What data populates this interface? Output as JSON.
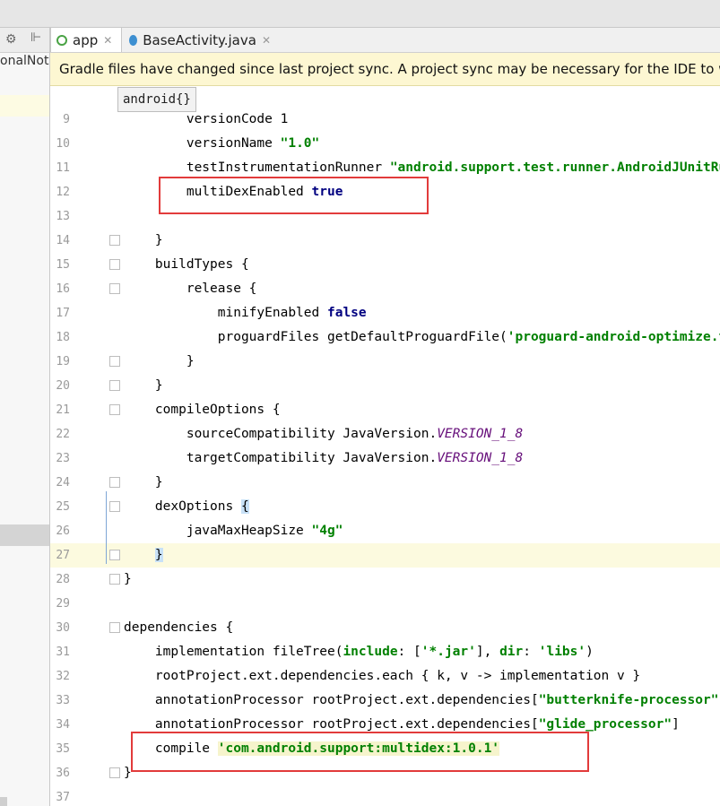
{
  "left_panel": {
    "text": "onalNot",
    "gear_icon": "⚙",
    "pin_icon": "⊩"
  },
  "tabs": [
    {
      "label": "app",
      "icon": "gradle-icon",
      "color": "#4aa345",
      "active": true
    },
    {
      "label": "BaseActivity.java",
      "icon": "class-icon",
      "color": "#3d8fd1",
      "active": false
    }
  ],
  "banner": {
    "text": "Gradle files have changed since last project sync. A project sync may be necessary for the IDE to work"
  },
  "breadcrumb": {
    "text": "android{}"
  },
  "lines": [
    {
      "n": "9",
      "html": "        versionCode 1"
    },
    {
      "n": "10",
      "html": "        versionName <span class=\"str\">\"1.0\"</span>"
    },
    {
      "n": "11",
      "html": "        testInstrumentationRunner <span class=\"str\">\"android.support.test.runner.AndroidJUnitRunner\"</span>"
    },
    {
      "n": "12",
      "html": "        multiDexEnabled <span class=\"kw\">true</span>"
    },
    {
      "n": "13",
      "html": ""
    },
    {
      "n": "14",
      "html": "    }"
    },
    {
      "n": "15",
      "html": "    buildTypes {"
    },
    {
      "n": "16",
      "html": "        release {"
    },
    {
      "n": "17",
      "html": "            minifyEnabled <span class=\"kw\">false</span>"
    },
    {
      "n": "18",
      "html": "            proguardFiles getDefaultProguardFile(<span class=\"str\">'proguard-android-optimize.txt'</span>)"
    },
    {
      "n": "19",
      "html": "        }"
    },
    {
      "n": "20",
      "html": "    }"
    },
    {
      "n": "21",
      "html": "    compileOptions {"
    },
    {
      "n": "22",
      "html": "        sourceCompatibility JavaVersion.<span class=\"const\">VERSION_1_8</span>"
    },
    {
      "n": "23",
      "html": "        targetCompatibility JavaVersion.<span class=\"const\">VERSION_1_8</span>"
    },
    {
      "n": "24",
      "html": "    }"
    },
    {
      "n": "25",
      "html": "    dexOptions <span class=\"brk\">{</span>"
    },
    {
      "n": "26",
      "html": "        javaMaxHeapSize <span class=\"str\">\"4g\"</span>"
    },
    {
      "n": "27",
      "html": "    <span class=\"brk\">}</span>"
    },
    {
      "n": "28",
      "html": "}"
    },
    {
      "n": "29",
      "html": ""
    },
    {
      "n": "30",
      "html": "dependencies {"
    },
    {
      "n": "31",
      "html": "    implementation fileTree(<span class=\"str\">include</span>: [<span class=\"str\">'*.jar'</span>], <span class=\"str\">dir</span>: <span class=\"str\">'libs'</span>)"
    },
    {
      "n": "32",
      "html": "    rootProject.ext.dependencies.each { k, v -&gt; implementation v }"
    },
    {
      "n": "33",
      "html": "    annotationProcessor rootProject.ext.dependencies[<span class=\"str\">\"butterknife-processor\"</span>]"
    },
    {
      "n": "34",
      "html": "    annotationProcessor rootProject.ext.dependencies[<span class=\"str\">\"glide_processor\"</span>]"
    },
    {
      "n": "35",
      "html": "    compile <span class=\"str strhl\">'com.android.support:multidex:1.0.1'</span>"
    },
    {
      "n": "36",
      "html": "}"
    },
    {
      "n": "37",
      "html": ""
    }
  ],
  "fold_lines": [
    "14",
    "15",
    "16",
    "19",
    "20",
    "21",
    "24",
    "25",
    "27",
    "28",
    "30",
    "36"
  ],
  "caret_line": "27",
  "colors": {
    "highlight_box": "#e23b3b",
    "string": "#008000",
    "keyword": "#000080"
  }
}
